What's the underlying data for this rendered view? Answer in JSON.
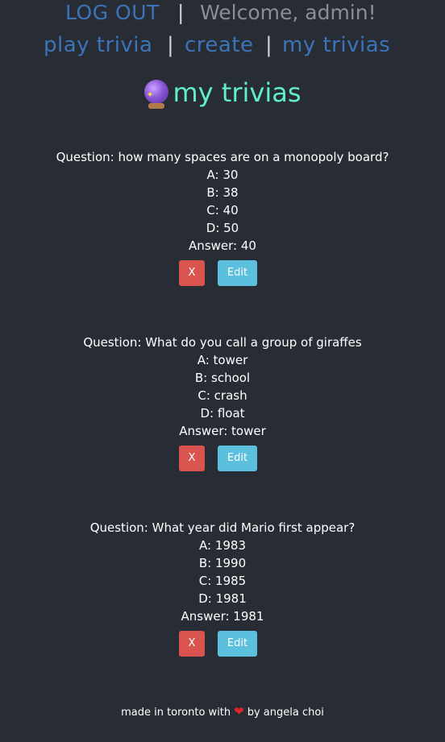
{
  "header": {
    "logout_label": "LOG OUT",
    "separator": "|",
    "welcome_text": "Welcome, admin!"
  },
  "nav": {
    "play_label": "play trivia",
    "create_label": "create",
    "my_trivias_label": "my trivias",
    "separator": "|"
  },
  "page_title": "my trivias",
  "page_title_icon": "crystal-ball-icon",
  "trivias": [
    {
      "question": "Question: how many spaces are on a monopoly board?",
      "a": "A: 30",
      "b": "B: 38",
      "c": "C: 40",
      "d": "D: 50",
      "answer": "Answer: 40",
      "delete_label": "X",
      "edit_label": "Edit"
    },
    {
      "question": "Question: What do you call a group of giraffes",
      "a": "A: tower",
      "b": "B: school",
      "c": "C: crash",
      "d": "D: float",
      "answer": "Answer: tower",
      "delete_label": "X",
      "edit_label": "Edit"
    },
    {
      "question": "Question: What year did Mario first appear?",
      "a": "A: 1983",
      "b": "B: 1990",
      "c": "C: 1985",
      "d": "D: 1981",
      "answer": "Answer: 1981",
      "delete_label": "X",
      "edit_label": "Edit"
    }
  ],
  "footer": {
    "prefix": "made in toronto with",
    "heart_icon": "heart-icon",
    "suffix": "by angela choi"
  },
  "colors": {
    "background": "#282c34",
    "link": "#3b74b8",
    "title": "#5ff0c7",
    "delete_button": "#d9534f",
    "edit_button": "#5bc0de"
  }
}
